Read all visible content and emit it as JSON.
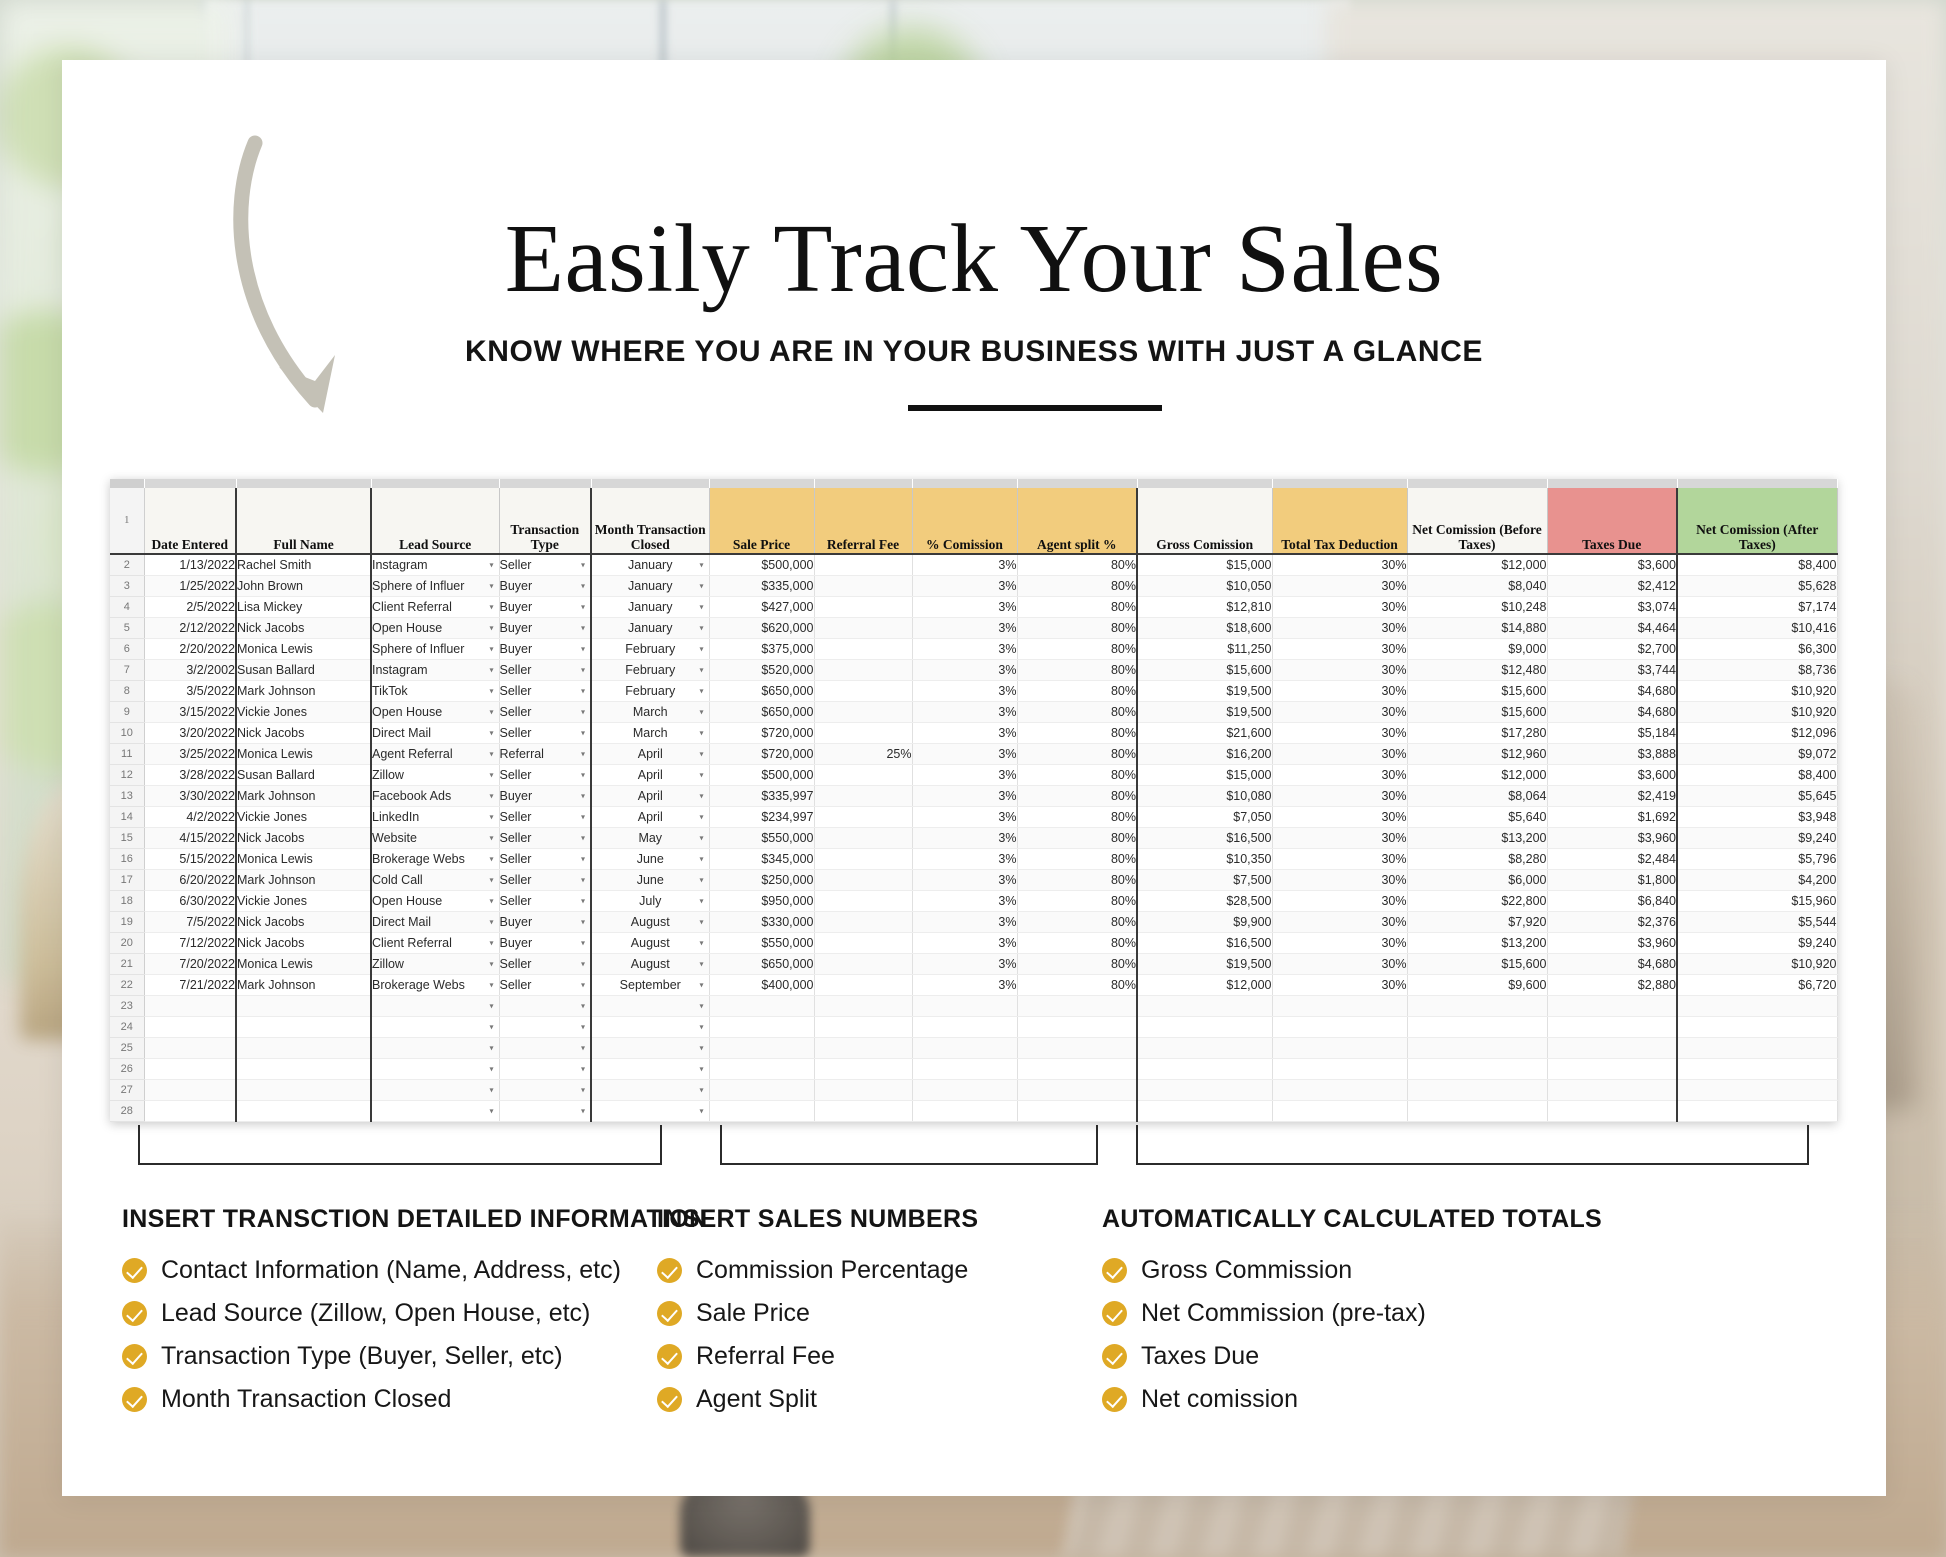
{
  "heading": {
    "title": "Easily Track Your Sales",
    "subtitle": "KNOW WHERE YOU ARE IN YOUR BUSINESS WITH JUST A GLANCE"
  },
  "spreadsheet": {
    "row_header_label": "1",
    "columns": [
      {
        "label": "Date Entered",
        "fill": "plain"
      },
      {
        "label": "Full Name",
        "fill": "plain"
      },
      {
        "label": "Lead Source",
        "fill": "plain"
      },
      {
        "label": "Transaction Type",
        "fill": "plain"
      },
      {
        "label": "Month Transaction Closed",
        "fill": "plain"
      },
      {
        "label": "Sale Price",
        "fill": "gold"
      },
      {
        "label": "Referral Fee",
        "fill": "gold"
      },
      {
        "label": "% Comission",
        "fill": "gold"
      },
      {
        "label": "Agent split %",
        "fill": "gold"
      },
      {
        "label": "Gross Comission",
        "fill": "plain"
      },
      {
        "label": "Total Tax Deduction",
        "fill": "gold"
      },
      {
        "label": "Net Comission (Before Taxes)",
        "fill": "plain"
      },
      {
        "label": "Taxes Due",
        "fill": "red"
      },
      {
        "label": "Net Comission (After Taxes)",
        "fill": "green"
      }
    ],
    "colors": {
      "gold": "#f2cc7d",
      "red": "#e8928f",
      "green": "#b2d69b"
    },
    "rows": [
      {
        "n": "2",
        "date": "1/13/2022",
        "name": "Rachel Smith",
        "lead": "Instagram",
        "type": "Seller",
        "month": "January",
        "price": "$500,000",
        "referral": "",
        "comm": "3%",
        "split": "80%",
        "gross": "$15,000",
        "tax": "30%",
        "netbefore": "$12,000",
        "taxes": "$3,600",
        "netafter": "$8,400"
      },
      {
        "n": "3",
        "date": "1/25/2022",
        "name": "John Brown",
        "lead": "Sphere of Influer",
        "type": "Buyer",
        "month": "January",
        "price": "$335,000",
        "referral": "",
        "comm": "3%",
        "split": "80%",
        "gross": "$10,050",
        "tax": "30%",
        "netbefore": "$8,040",
        "taxes": "$2,412",
        "netafter": "$5,628"
      },
      {
        "n": "4",
        "date": "2/5/2022",
        "name": "Lisa Mickey",
        "lead": "Client Referral",
        "type": "Buyer",
        "month": "January",
        "price": "$427,000",
        "referral": "",
        "comm": "3%",
        "split": "80%",
        "gross": "$12,810",
        "tax": "30%",
        "netbefore": "$10,248",
        "taxes": "$3,074",
        "netafter": "$7,174"
      },
      {
        "n": "5",
        "date": "2/12/2022",
        "name": "Nick Jacobs",
        "lead": "Open House",
        "type": "Buyer",
        "month": "January",
        "price": "$620,000",
        "referral": "",
        "comm": "3%",
        "split": "80%",
        "gross": "$18,600",
        "tax": "30%",
        "netbefore": "$14,880",
        "taxes": "$4,464",
        "netafter": "$10,416"
      },
      {
        "n": "6",
        "date": "2/20/2022",
        "name": "Monica Lewis",
        "lead": "Sphere of Influer",
        "type": "Buyer",
        "month": "February",
        "price": "$375,000",
        "referral": "",
        "comm": "3%",
        "split": "80%",
        "gross": "$11,250",
        "tax": "30%",
        "netbefore": "$9,000",
        "taxes": "$2,700",
        "netafter": "$6,300"
      },
      {
        "n": "7",
        "date": "3/2/2002",
        "name": "Susan Ballard",
        "lead": "Instagram",
        "type": "Seller",
        "month": "February",
        "price": "$520,000",
        "referral": "",
        "comm": "3%",
        "split": "80%",
        "gross": "$15,600",
        "tax": "30%",
        "netbefore": "$12,480",
        "taxes": "$3,744",
        "netafter": "$8,736"
      },
      {
        "n": "8",
        "date": "3/5/2022",
        "name": "Mark Johnson",
        "lead": "TikTok",
        "type": "Seller",
        "month": "February",
        "price": "$650,000",
        "referral": "",
        "comm": "3%",
        "split": "80%",
        "gross": "$19,500",
        "tax": "30%",
        "netbefore": "$15,600",
        "taxes": "$4,680",
        "netafter": "$10,920"
      },
      {
        "n": "9",
        "date": "3/15/2022",
        "name": "Vickie Jones",
        "lead": "Open House",
        "type": "Seller",
        "month": "March",
        "price": "$650,000",
        "referral": "",
        "comm": "3%",
        "split": "80%",
        "gross": "$19,500",
        "tax": "30%",
        "netbefore": "$15,600",
        "taxes": "$4,680",
        "netafter": "$10,920"
      },
      {
        "n": "10",
        "date": "3/20/2022",
        "name": "Nick Jacobs",
        "lead": "Direct Mail",
        "type": "Seller",
        "month": "March",
        "price": "$720,000",
        "referral": "",
        "comm": "3%",
        "split": "80%",
        "gross": "$21,600",
        "tax": "30%",
        "netbefore": "$17,280",
        "taxes": "$5,184",
        "netafter": "$12,096"
      },
      {
        "n": "11",
        "date": "3/25/2022",
        "name": "Monica Lewis",
        "lead": "Agent Referral",
        "type": "Referral",
        "month": "April",
        "price": "$720,000",
        "referral": "25%",
        "comm": "3%",
        "split": "80%",
        "gross": "$16,200",
        "tax": "30%",
        "netbefore": "$12,960",
        "taxes": "$3,888",
        "netafter": "$9,072"
      },
      {
        "n": "12",
        "date": "3/28/2022",
        "name": "Susan Ballard",
        "lead": "Zillow",
        "type": "Seller",
        "month": "April",
        "price": "$500,000",
        "referral": "",
        "comm": "3%",
        "split": "80%",
        "gross": "$15,000",
        "tax": "30%",
        "netbefore": "$12,000",
        "taxes": "$3,600",
        "netafter": "$8,400"
      },
      {
        "n": "13",
        "date": "3/30/2022",
        "name": "Mark Johnson",
        "lead": "Facebook Ads",
        "type": "Buyer",
        "month": "April",
        "price": "$335,997",
        "referral": "",
        "comm": "3%",
        "split": "80%",
        "gross": "$10,080",
        "tax": "30%",
        "netbefore": "$8,064",
        "taxes": "$2,419",
        "netafter": "$5,645"
      },
      {
        "n": "14",
        "date": "4/2/2022",
        "name": "Vickie Jones",
        "lead": "LinkedIn",
        "type": "Seller",
        "month": "April",
        "price": "$234,997",
        "referral": "",
        "comm": "3%",
        "split": "80%",
        "gross": "$7,050",
        "tax": "30%",
        "netbefore": "$5,640",
        "taxes": "$1,692",
        "netafter": "$3,948"
      },
      {
        "n": "15",
        "date": "4/15/2022",
        "name": "Nick Jacobs",
        "lead": "Website",
        "type": "Seller",
        "month": "May",
        "price": "$550,000",
        "referral": "",
        "comm": "3%",
        "split": "80%",
        "gross": "$16,500",
        "tax": "30%",
        "netbefore": "$13,200",
        "taxes": "$3,960",
        "netafter": "$9,240"
      },
      {
        "n": "16",
        "date": "5/15/2022",
        "name": "Monica Lewis",
        "lead": "Brokerage Webs",
        "type": "Seller",
        "month": "June",
        "price": "$345,000",
        "referral": "",
        "comm": "3%",
        "split": "80%",
        "gross": "$10,350",
        "tax": "30%",
        "netbefore": "$8,280",
        "taxes": "$2,484",
        "netafter": "$5,796"
      },
      {
        "n": "17",
        "date": "6/20/2022",
        "name": "Mark Johnson",
        "lead": "Cold Call",
        "type": "Seller",
        "month": "June",
        "price": "$250,000",
        "referral": "",
        "comm": "3%",
        "split": "80%",
        "gross": "$7,500",
        "tax": "30%",
        "netbefore": "$6,000",
        "taxes": "$1,800",
        "netafter": "$4,200"
      },
      {
        "n": "18",
        "date": "6/30/2022",
        "name": "Vickie Jones",
        "lead": "Open House",
        "type": "Seller",
        "month": "July",
        "price": "$950,000",
        "referral": "",
        "comm": "3%",
        "split": "80%",
        "gross": "$28,500",
        "tax": "30%",
        "netbefore": "$22,800",
        "taxes": "$6,840",
        "netafter": "$15,960"
      },
      {
        "n": "19",
        "date": "7/5/2022",
        "name": "Nick Jacobs",
        "lead": "Direct Mail",
        "type": "Buyer",
        "month": "August",
        "price": "$330,000",
        "referral": "",
        "comm": "3%",
        "split": "80%",
        "gross": "$9,900",
        "tax": "30%",
        "netbefore": "$7,920",
        "taxes": "$2,376",
        "netafter": "$5,544"
      },
      {
        "n": "20",
        "date": "7/12/2022",
        "name": "Nick Jacobs",
        "lead": "Client Referral",
        "type": "Buyer",
        "month": "August",
        "price": "$550,000",
        "referral": "",
        "comm": "3%",
        "split": "80%",
        "gross": "$16,500",
        "tax": "30%",
        "netbefore": "$13,200",
        "taxes": "$3,960",
        "netafter": "$9,240"
      },
      {
        "n": "21",
        "date": "7/20/2022",
        "name": "Monica Lewis",
        "lead": "Zillow",
        "type": "Seller",
        "month": "August",
        "price": "$650,000",
        "referral": "",
        "comm": "3%",
        "split": "80%",
        "gross": "$19,500",
        "tax": "30%",
        "netbefore": "$15,600",
        "taxes": "$4,680",
        "netafter": "$10,920"
      },
      {
        "n": "22",
        "date": "7/21/2022",
        "name": "Mark Johnson",
        "lead": "Brokerage Webs",
        "type": "Seller",
        "month": "September",
        "price": "$400,000",
        "referral": "",
        "comm": "3%",
        "split": "80%",
        "gross": "$12,000",
        "tax": "30%",
        "netbefore": "$9,600",
        "taxes": "$2,880",
        "netafter": "$6,720"
      },
      {
        "n": "23",
        "date": "",
        "name": "",
        "lead": "",
        "type": "",
        "month": "",
        "price": "",
        "referral": "",
        "comm": "",
        "split": "",
        "gross": "",
        "tax": "",
        "netbefore": "",
        "taxes": "",
        "netafter": ""
      },
      {
        "n": "24",
        "date": "",
        "name": "",
        "lead": "",
        "type": "",
        "month": "",
        "price": "",
        "referral": "",
        "comm": "",
        "split": "",
        "gross": "",
        "tax": "",
        "netbefore": "",
        "taxes": "",
        "netafter": ""
      },
      {
        "n": "25",
        "date": "",
        "name": "",
        "lead": "",
        "type": "",
        "month": "",
        "price": "",
        "referral": "",
        "comm": "",
        "split": "",
        "gross": "",
        "tax": "",
        "netbefore": "",
        "taxes": "",
        "netafter": ""
      },
      {
        "n": "26",
        "date": "",
        "name": "",
        "lead": "",
        "type": "",
        "month": "",
        "price": "",
        "referral": "",
        "comm": "",
        "split": "",
        "gross": "",
        "tax": "",
        "netbefore": "",
        "taxes": "",
        "netafter": ""
      },
      {
        "n": "27",
        "date": "",
        "name": "",
        "lead": "",
        "type": "",
        "month": "",
        "price": "",
        "referral": "",
        "comm": "",
        "split": "",
        "gross": "",
        "tax": "",
        "netbefore": "",
        "taxes": "",
        "netafter": ""
      },
      {
        "n": "28",
        "date": "",
        "name": "",
        "lead": "",
        "type": "",
        "month": "",
        "price": "",
        "referral": "",
        "comm": "",
        "split": "",
        "gross": "",
        "tax": "",
        "netbefore": "",
        "taxes": "",
        "netafter": ""
      }
    ]
  },
  "features": [
    {
      "heading": "INSERT TRANSCTION DETAILED INFORMATION",
      "items": [
        "Contact Information (Name, Address, etc)",
        "Lead Source (Zillow, Open House, etc)",
        "Transaction Type (Buyer, Seller, etc)",
        "Month Transaction Closed"
      ]
    },
    {
      "heading": "INSERT SALES NUMBERS",
      "items": [
        "Commission Percentage",
        "Sale Price",
        "Referral Fee",
        "Agent Split"
      ]
    },
    {
      "heading": "AUTOMATICALLY CALCULATED TOTALS",
      "items": [
        "Gross Commission",
        "Net Commission (pre-tax)",
        "Taxes Due",
        "Net comission"
      ]
    }
  ],
  "accent_colors": {
    "check_badge": "#dfa925",
    "arrow": "#c4c1b6"
  }
}
